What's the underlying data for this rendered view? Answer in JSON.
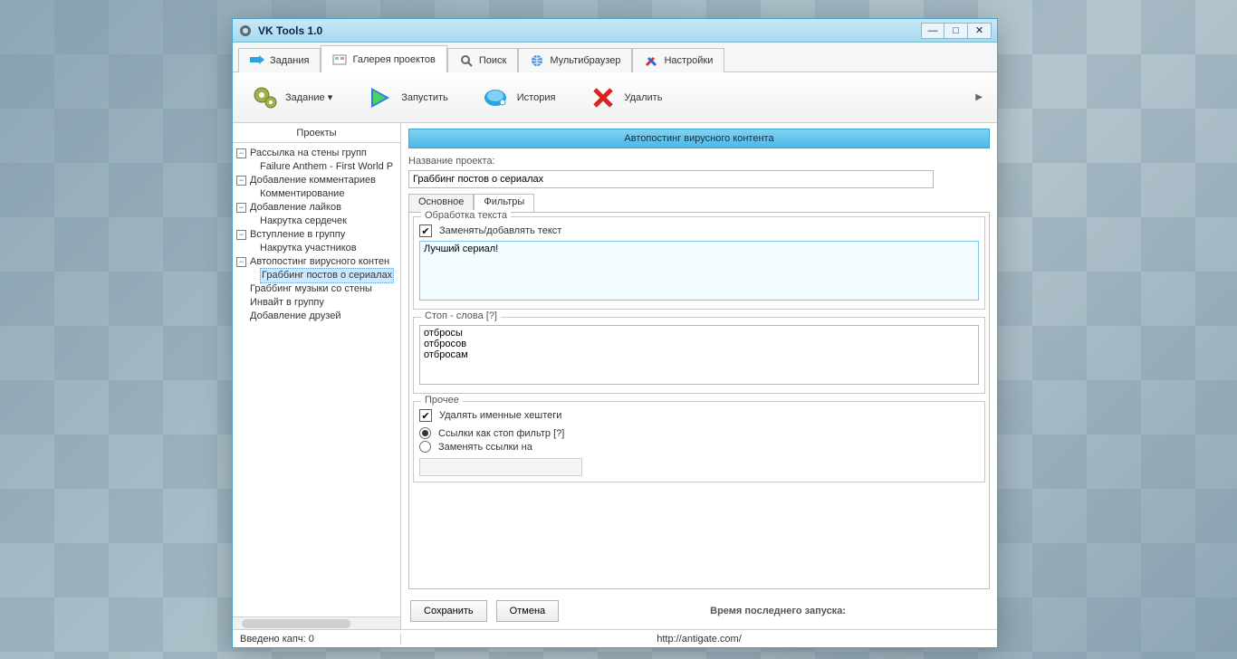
{
  "window": {
    "title": "VK Tools  1.0"
  },
  "tabs": [
    {
      "label": "Задания"
    },
    {
      "label": "Галерея проектов"
    },
    {
      "label": "Поиск"
    },
    {
      "label": "Мультибраузер"
    },
    {
      "label": "Настройки"
    }
  ],
  "toolbar": {
    "task": "Задание",
    "run": "Запустить",
    "history": "История",
    "delete": "Удалить"
  },
  "sidebar": {
    "header": "Проекты",
    "tree": {
      "n0": "Рассылка на стены групп",
      "n0a": "Failure Anthem - First World P",
      "n1": "Добавление комментариев",
      "n1a": "Комментирование",
      "n2": "Добавление лайков",
      "n2a": "Накрутка сердечек",
      "n3": "Вступление в группу",
      "n3a": "Накрутка участников",
      "n4": "Автопостинг вирусного контен",
      "n4a": "Граббинг постов о сериалах",
      "n5": "Граббинг музыки со стены",
      "n6": "Инвайт в группу",
      "n7": "Добавление друзей"
    }
  },
  "main": {
    "header": "Автопостинг вирусного контента",
    "project_name_label": "Название проекта:",
    "project_name_value": "Граббинг постов о сериалах",
    "subtabs": {
      "basic": "Основное",
      "filters": "Фильтры"
    },
    "group_text": "Обработка текста",
    "replace_label": "Заменять/добавлять текст",
    "replace_value": "Лучший сериал!",
    "group_stop": "Стоп - слова [?]",
    "stop_value": "отбросы\nотбросов\nотбросам",
    "group_other": "Прочее",
    "del_hashtags": "Удалять именные хештеги",
    "links_stop": "Ссылки как стоп фильтр [?]",
    "links_replace": "Заменять ссылки на",
    "save": "Сохранить",
    "cancel": "Отмена",
    "lastrun": "Время последнего запуска:"
  },
  "status": {
    "captcha": "Введено капч: 0",
    "url": "http://antigate.com/"
  }
}
